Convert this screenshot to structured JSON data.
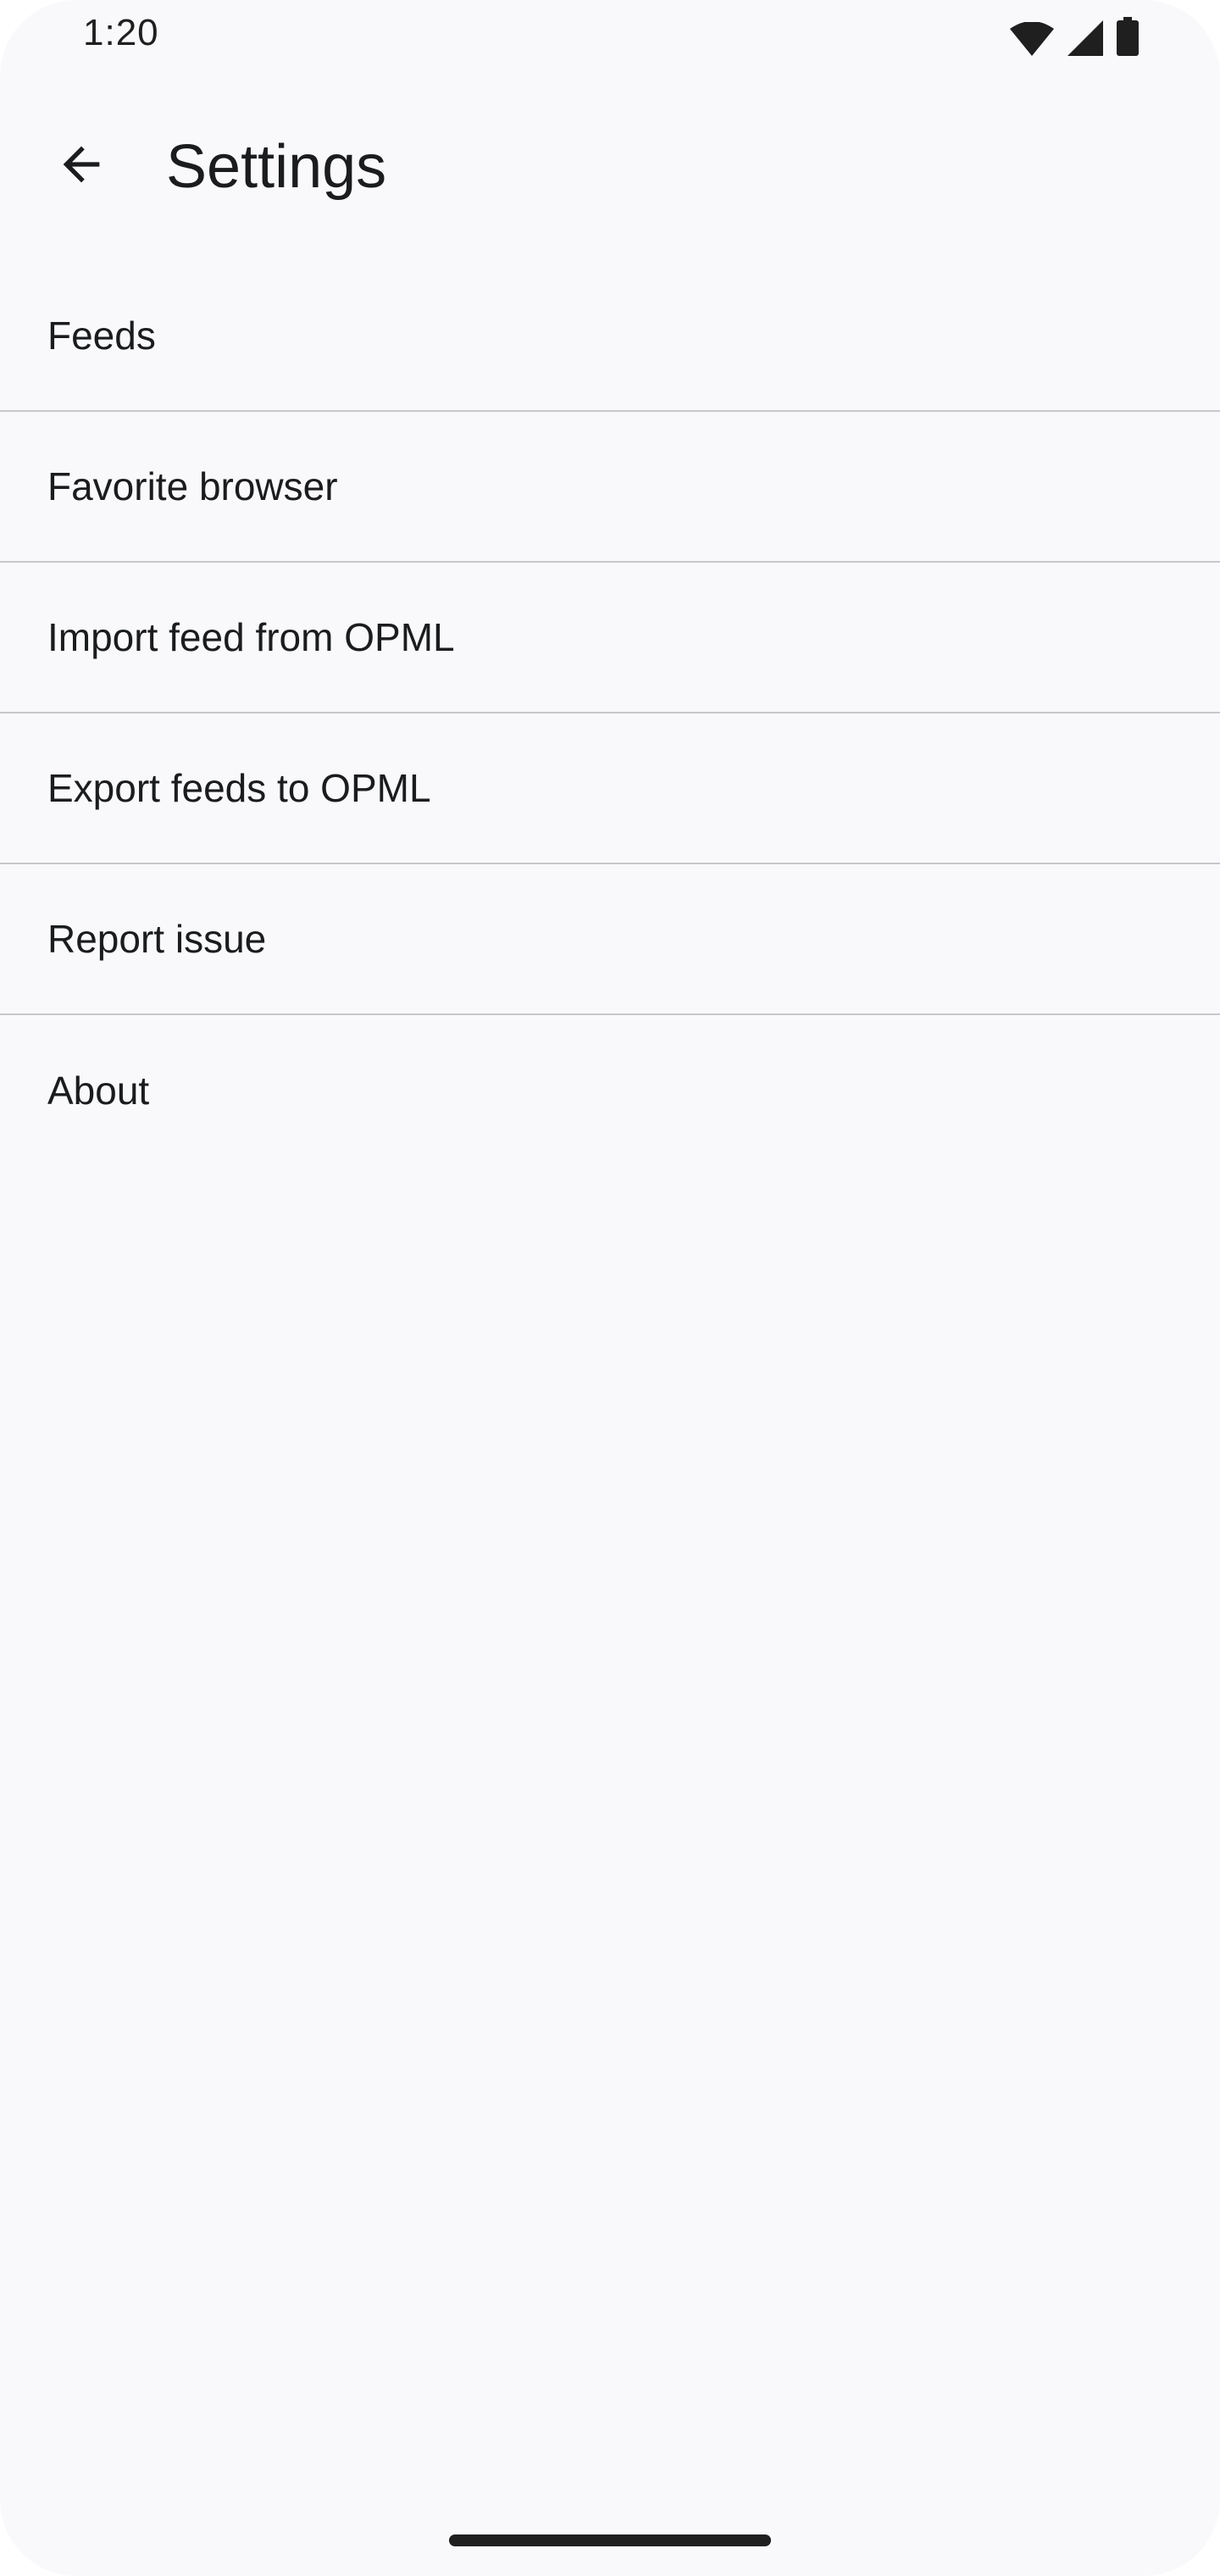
{
  "status_bar": {
    "time": "1:20",
    "icons": [
      "wifi-icon",
      "cellular-signal-icon",
      "battery-icon"
    ]
  },
  "app_bar": {
    "back_icon": "arrow-back-icon",
    "title": "Settings"
  },
  "settings": {
    "items": [
      {
        "label": "Feeds"
      },
      {
        "label": "Favorite browser"
      },
      {
        "label": "Import feed from OPML"
      },
      {
        "label": "Export feeds to OPML"
      },
      {
        "label": "Report issue"
      },
      {
        "label": "About"
      }
    ]
  },
  "colors": {
    "background": "#f9f9fc",
    "text": "#1a1c1e",
    "divider": "#c8c8cc"
  }
}
